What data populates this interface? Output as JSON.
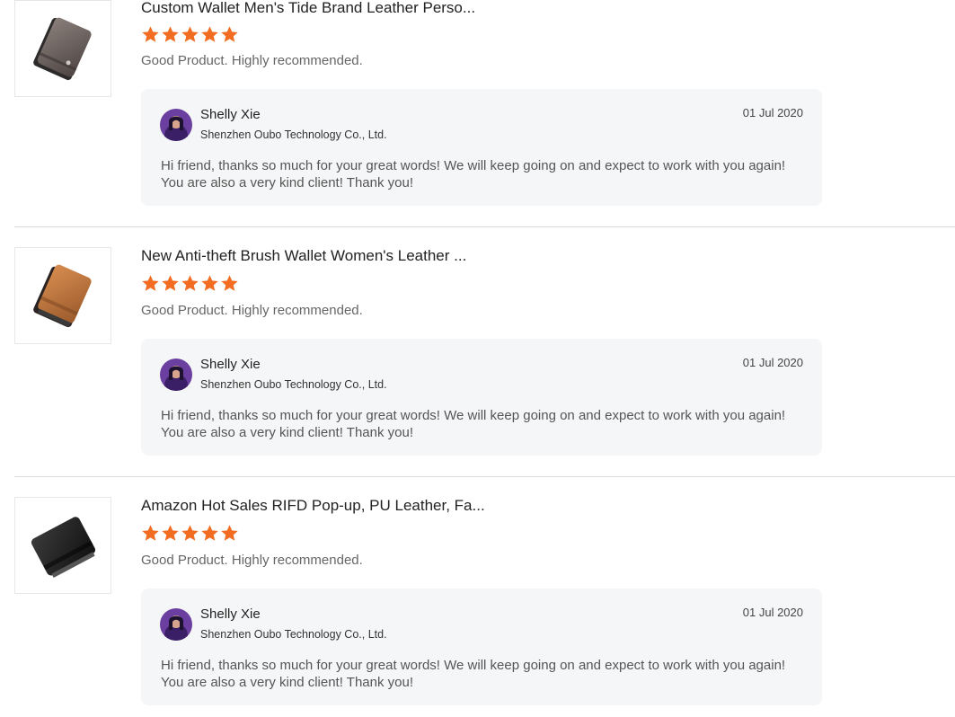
{
  "colors": {
    "star": "#f26d21",
    "reply_bg": "#f5f6f7",
    "divider": "#dcdcdc"
  },
  "icons": {
    "rating": "star-icon"
  },
  "reviews": [
    {
      "product_title": "Custom Wallet Men's Tide Brand Leather Perso...",
      "rating": 5,
      "comment": "Good Product. Highly recommended.",
      "product_color": "brown-gray",
      "reply": {
        "name": "Shelly Xie",
        "company": "Shenzhen Oubo Technology Co., Ltd.",
        "date": "01 Jul 2020",
        "text": "Hi friend, thanks so much for your great words! We will keep going on and expect to work with you again! You are also a very kind client! Thank you!"
      }
    },
    {
      "product_title": "New Anti-theft Brush Wallet Women's Leather ...",
      "rating": 5,
      "comment": "Good Product. Highly recommended.",
      "product_color": "tan",
      "reply": {
        "name": "Shelly Xie",
        "company": "Shenzhen Oubo Technology Co., Ltd.",
        "date": "01 Jul 2020",
        "text": "Hi friend, thanks so much for your great words! We will keep going on and expect to work with you again! You are also a very kind client! Thank you!"
      }
    },
    {
      "product_title": "Amazon Hot Sales RIFD Pop-up, PU Leather, Fa...",
      "rating": 5,
      "comment": "Good Product. Highly recommended.",
      "product_color": "black",
      "reply": {
        "name": "Shelly Xie",
        "company": "Shenzhen Oubo Technology Co., Ltd.",
        "date": "01 Jul 2020",
        "text": "Hi friend, thanks so much for your great words! We will keep going on and expect to work with you again! You are also a very kind client! Thank you!"
      }
    }
  ]
}
